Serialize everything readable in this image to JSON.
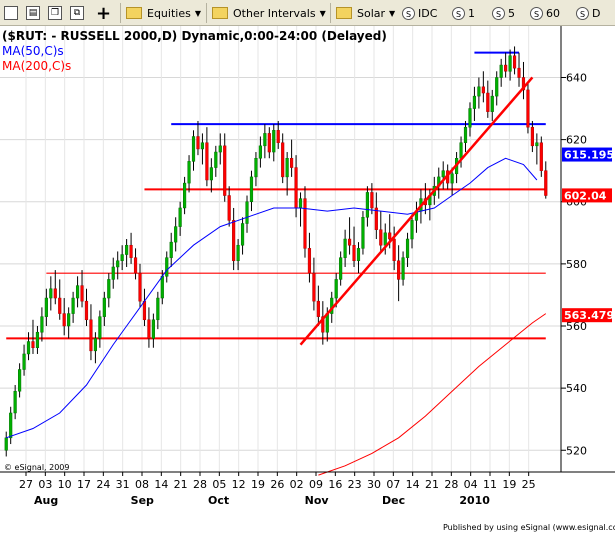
{
  "toolbar": {
    "items": [
      {
        "name": "ticker-box",
        "label": "",
        "kind": "box"
      },
      {
        "name": "print-button",
        "label": "",
        "kind": "icon",
        "glyph": "▤"
      },
      {
        "name": "copy-button",
        "label": "",
        "kind": "icon",
        "glyph": "❐"
      },
      {
        "name": "link-button",
        "label": "",
        "kind": "icon",
        "glyph": "⧉"
      },
      {
        "name": "add-button",
        "label": "+",
        "kind": "plus"
      },
      {
        "name": "equities-menu",
        "label": "Equities",
        "kind": "folder"
      },
      {
        "name": "other-intervals-menu",
        "label": "Other Intervals",
        "kind": "folder"
      },
      {
        "name": "solar-menu",
        "label": "Solar",
        "kind": "folder"
      },
      {
        "name": "interval-idc",
        "label": "IDC",
        "kind": "circle",
        "glyph": "S"
      },
      {
        "name": "interval-1",
        "label": "1",
        "kind": "circle",
        "glyph": "S"
      },
      {
        "name": "interval-5",
        "label": "5",
        "kind": "circle",
        "glyph": "S"
      },
      {
        "name": "interval-60",
        "label": "60",
        "kind": "circle",
        "glyph": "S"
      },
      {
        "name": "interval-d",
        "label": "D",
        "kind": "circle",
        "glyph": "S"
      }
    ]
  },
  "chart_data": {
    "type": "candlestick",
    "title": "($RUT: - RUSSELL 2000,D) Dynamic,0:00-24:00 (Delayed)",
    "legend": [
      {
        "label": "MA(50,C)s",
        "color": "#0000ff"
      },
      {
        "label": "MA(200,C)s",
        "color": "#ff0000"
      }
    ],
    "ylim": [
      513,
      654
    ],
    "yticks": [
      520,
      540,
      560,
      580,
      600,
      620,
      640
    ],
    "price_tags": [
      {
        "value": 615.195,
        "label": "615.195",
        "color": "#0000ff"
      },
      {
        "value": 602.04,
        "label": "602.04",
        "color": "#ff0000"
      },
      {
        "value": 563.479,
        "label": "563.479",
        "color": "#ff0000"
      }
    ],
    "xtick_labels": [
      "27",
      "03",
      "10",
      "17",
      "24",
      "31",
      "08",
      "14",
      "21",
      "28",
      "05",
      "12",
      "19",
      "26",
      "02",
      "09",
      "16",
      "23",
      "30",
      "07",
      "14",
      "21",
      "28",
      "04",
      "11",
      "19",
      "25"
    ],
    "month_labels": [
      "Aug",
      "Sep",
      "Oct",
      "Nov",
      "Dec",
      "2010"
    ],
    "ohlc": [
      [
        520,
        526,
        518,
        524
      ],
      [
        524,
        534,
        522,
        532
      ],
      [
        532,
        541,
        530,
        539
      ],
      [
        539,
        548,
        537,
        546
      ],
      [
        546,
        554,
        544,
        551
      ],
      [
        551,
        558,
        549,
        555
      ],
      [
        555,
        562,
        551,
        553
      ],
      [
        553,
        560,
        551,
        558
      ],
      [
        558,
        566,
        555,
        563
      ],
      [
        563,
        572,
        560,
        569
      ],
      [
        569,
        576,
        565,
        572
      ],
      [
        572,
        578,
        567,
        569
      ],
      [
        569,
        575,
        562,
        564
      ],
      [
        564,
        569,
        557,
        560
      ],
      [
        560,
        566,
        556,
        564
      ],
      [
        564,
        571,
        561,
        569
      ],
      [
        569,
        576,
        566,
        573
      ],
      [
        573,
        578,
        566,
        568
      ],
      [
        568,
        572,
        560,
        562
      ],
      [
        562,
        567,
        549,
        552
      ],
      [
        552,
        558,
        548,
        556
      ],
      [
        556,
        565,
        553,
        563
      ],
      [
        563,
        571,
        560,
        569
      ],
      [
        569,
        577,
        566,
        575
      ],
      [
        575,
        582,
        572,
        579
      ],
      [
        579,
        584,
        575,
        581
      ],
      [
        581,
        586,
        578,
        583
      ],
      [
        583,
        588,
        579,
        586
      ],
      [
        586,
        590,
        580,
        582
      ],
      [
        582,
        585,
        575,
        577
      ],
      [
        577,
        580,
        566,
        568
      ],
      [
        568,
        572,
        560,
        562
      ],
      [
        562,
        566,
        553,
        556
      ],
      [
        556,
        564,
        553,
        562
      ],
      [
        562,
        571,
        559,
        569
      ],
      [
        569,
        578,
        567,
        576
      ],
      [
        576,
        584,
        574,
        582
      ],
      [
        582,
        590,
        579,
        587
      ],
      [
        587,
        595,
        584,
        592
      ],
      [
        592,
        600,
        589,
        598
      ],
      [
        598,
        608,
        596,
        606
      ],
      [
        606,
        615,
        603,
        613
      ],
      [
        613,
        623,
        610,
        621
      ],
      [
        621,
        626,
        615,
        617
      ],
      [
        617,
        622,
        612,
        619
      ],
      [
        619,
        624,
        605,
        607
      ],
      [
        607,
        614,
        603,
        611
      ],
      [
        611,
        618,
        608,
        616
      ],
      [
        616,
        622,
        612,
        618
      ],
      [
        618,
        622,
        600,
        602
      ],
      [
        602,
        605,
        592,
        594
      ],
      [
        594,
        598,
        578,
        581
      ],
      [
        581,
        588,
        578,
        586
      ],
      [
        586,
        595,
        583,
        593
      ],
      [
        593,
        602,
        590,
        600
      ],
      [
        600,
        610,
        597,
        608
      ],
      [
        608,
        616,
        605,
        614
      ],
      [
        614,
        621,
        611,
        618
      ],
      [
        618,
        625,
        614,
        622
      ],
      [
        622,
        624,
        614,
        616
      ],
      [
        616,
        625,
        613,
        623
      ],
      [
        623,
        626,
        617,
        619
      ],
      [
        619,
        622,
        606,
        608
      ],
      [
        608,
        616,
        602,
        614
      ],
      [
        614,
        620,
        608,
        611
      ],
      [
        611,
        615,
        595,
        598
      ],
      [
        598,
        603,
        592,
        601
      ],
      [
        601,
        605,
        582,
        585
      ],
      [
        585,
        590,
        574,
        577
      ],
      [
        577,
        582,
        565,
        568
      ],
      [
        568,
        573,
        560,
        563
      ],
      [
        563,
        568,
        554,
        558
      ],
      [
        558,
        566,
        555,
        564
      ],
      [
        564,
        571,
        561,
        569
      ],
      [
        569,
        577,
        566,
        575
      ],
      [
        575,
        584,
        573,
        582
      ],
      [
        582,
        591,
        579,
        588
      ],
      [
        588,
        595,
        583,
        586
      ],
      [
        586,
        592,
        579,
        581
      ],
      [
        581,
        587,
        577,
        585
      ],
      [
        585,
        597,
        583,
        595
      ],
      [
        595,
        605,
        592,
        603
      ],
      [
        603,
        606,
        596,
        598
      ],
      [
        598,
        603,
        588,
        591
      ],
      [
        591,
        597,
        584,
        586
      ],
      [
        586,
        593,
        583,
        590
      ],
      [
        590,
        596,
        585,
        588
      ],
      [
        588,
        592,
        578,
        581
      ],
      [
        581,
        586,
        568,
        575
      ],
      [
        575,
        584,
        573,
        582
      ],
      [
        582,
        590,
        579,
        588
      ],
      [
        588,
        596,
        585,
        594
      ],
      [
        594,
        600,
        590,
        597
      ],
      [
        597,
        604,
        593,
        601
      ],
      [
        601,
        606,
        596,
        599
      ],
      [
        599,
        604,
        594,
        602
      ],
      [
        602,
        608,
        599,
        605
      ],
      [
        605,
        611,
        601,
        608
      ],
      [
        608,
        613,
        604,
        610
      ],
      [
        610,
        612,
        604,
        606
      ],
      [
        606,
        611,
        602,
        609
      ],
      [
        609,
        616,
        606,
        614
      ],
      [
        614,
        621,
        611,
        619
      ],
      [
        619,
        626,
        616,
        624
      ],
      [
        624,
        632,
        621,
        630
      ],
      [
        630,
        637,
        626,
        634
      ],
      [
        634,
        640,
        630,
        637
      ],
      [
        637,
        642,
        632,
        635
      ],
      [
        635,
        639,
        627,
        629
      ],
      [
        629,
        636,
        626,
        634
      ],
      [
        634,
        642,
        631,
        640
      ],
      [
        640,
        646,
        637,
        644
      ],
      [
        644,
        648,
        640,
        642
      ],
      [
        642,
        649,
        639,
        647
      ],
      [
        647,
        650,
        641,
        643
      ],
      [
        643,
        648,
        637,
        640
      ],
      [
        640,
        645,
        633,
        636
      ],
      [
        636,
        638,
        622,
        624
      ],
      [
        624,
        626,
        616,
        618
      ],
      [
        618,
        622,
        612,
        619
      ],
      [
        619,
        621,
        608,
        610
      ],
      [
        610,
        613,
        601,
        602
      ]
    ],
    "ma50": [
      [
        0,
        524
      ],
      [
        6,
        527
      ],
      [
        12,
        532
      ],
      [
        18,
        541
      ],
      [
        24,
        554
      ],
      [
        30,
        566
      ],
      [
        36,
        578
      ],
      [
        42,
        586
      ],
      [
        48,
        592
      ],
      [
        54,
        595
      ],
      [
        60,
        598
      ],
      [
        66,
        598
      ],
      [
        72,
        597
      ],
      [
        78,
        598
      ],
      [
        84,
        597
      ],
      [
        90,
        596
      ],
      [
        96,
        598
      ],
      [
        100,
        602
      ],
      [
        104,
        606
      ],
      [
        108,
        611
      ],
      [
        112,
        614
      ],
      [
        116,
        612
      ],
      [
        119,
        607
      ]
    ],
    "ma200": [
      [
        70,
        512
      ],
      [
        76,
        515
      ],
      [
        82,
        519
      ],
      [
        88,
        524
      ],
      [
        94,
        531
      ],
      [
        100,
        539
      ],
      [
        106,
        547
      ],
      [
        112,
        554
      ],
      [
        118,
        561
      ],
      [
        121,
        564
      ]
    ],
    "hlines": [
      {
        "y": 648,
        "x0": 105,
        "x1": 115,
        "color": "#0000ff",
        "width": 2
      },
      {
        "y": 625,
        "x0": 37,
        "x1": 121,
        "color": "#0000ff",
        "width": 2
      },
      {
        "y": 604,
        "x0": 31,
        "x1": 121,
        "color": "#ff0000",
        "width": 2
      },
      {
        "y": 577,
        "x0": 9,
        "x1": 121,
        "color": "#ff0000",
        "width": 1.2
      },
      {
        "y": 556,
        "x0": 0,
        "x1": 121,
        "color": "#ff0000",
        "width": 2
      }
    ],
    "trendlines": [
      {
        "x0": 66,
        "y0": 554,
        "x1": 118,
        "y1": 640,
        "color": "#ff0000",
        "width": 2.5
      }
    ],
    "credits": {
      "left": "© eSignal, 2009",
      "right": "Published by using eSignal (www.esignal.com)"
    }
  }
}
